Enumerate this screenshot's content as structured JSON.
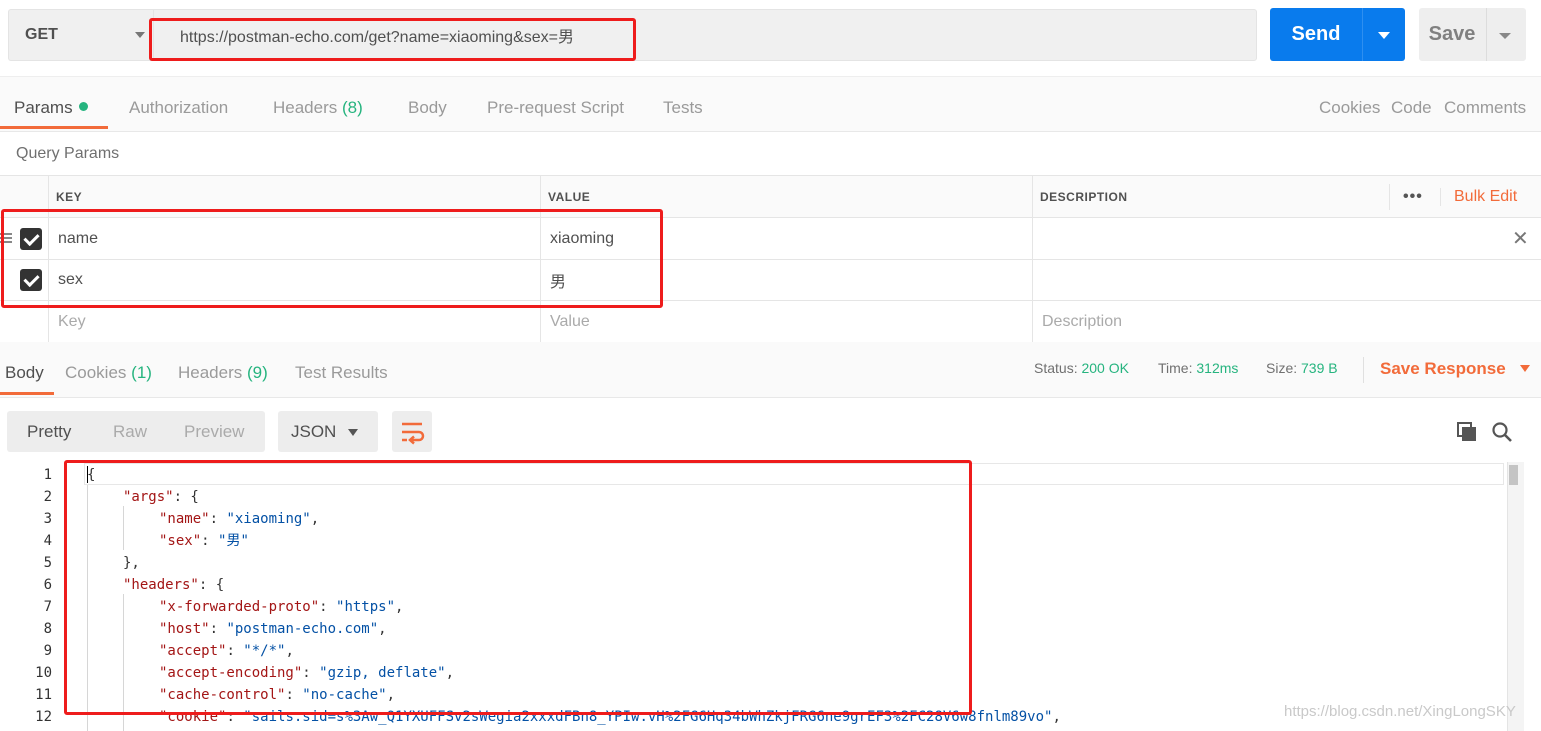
{
  "request": {
    "method": "GET",
    "url": "https://postman-echo.com/get?name=xiaoming&sex=男",
    "send_label": "Send",
    "save_label": "Save"
  },
  "request_tabs": [
    {
      "label": "Params",
      "active": true
    },
    {
      "label": "Authorization"
    },
    {
      "label": "Headers",
      "count": "(8)"
    },
    {
      "label": "Body"
    },
    {
      "label": "Pre-request Script"
    },
    {
      "label": "Tests"
    }
  ],
  "right_links": {
    "cookies": "Cookies",
    "code": "Code",
    "comments": "Comments"
  },
  "query_params": {
    "title": "Query Params",
    "headers": {
      "key": "KEY",
      "value": "VALUE",
      "description": "DESCRIPTION",
      "more": "•••",
      "bulk_edit": "Bulk Edit"
    },
    "rows": [
      {
        "key": "name",
        "value": "xiaoming",
        "checked": true
      },
      {
        "key": "sex",
        "value": "男",
        "checked": true
      }
    ],
    "placeholders": {
      "key": "Key",
      "value": "Value",
      "description": "Description"
    }
  },
  "response_tabs": [
    {
      "label": "Body",
      "active": true
    },
    {
      "label": "Cookies",
      "count": "(1)"
    },
    {
      "label": "Headers",
      "count": "(9)"
    },
    {
      "label": "Test Results"
    }
  ],
  "response_status": {
    "status_label": "Status:",
    "status_value": "200 OK",
    "time_label": "Time:",
    "time_value": "312ms",
    "size_label": "Size:",
    "size_value": "739 B",
    "save_response": "Save Response"
  },
  "view_modes": [
    "Pretty",
    "Raw",
    "Preview"
  ],
  "format": "JSON",
  "code_lines": [
    {
      "n": "1",
      "text": "{"
    },
    {
      "n": "2",
      "key": "\"args\"",
      "rest": ": {"
    },
    {
      "n": "3",
      "key": "\"name\"",
      "sep": ": ",
      "str": "\"xiaoming\"",
      "rest": ","
    },
    {
      "n": "4",
      "key": "\"sex\"",
      "sep": ": ",
      "str": "\"男\""
    },
    {
      "n": "5",
      "text": "},"
    },
    {
      "n": "6",
      "key": "\"headers\"",
      "rest": ": {"
    },
    {
      "n": "7",
      "key": "\"x-forwarded-proto\"",
      "sep": ": ",
      "str": "\"https\"",
      "rest": ","
    },
    {
      "n": "8",
      "key": "\"host\"",
      "sep": ": ",
      "str": "\"postman-echo.com\"",
      "rest": ","
    },
    {
      "n": "9",
      "key": "\"accept\"",
      "sep": ": ",
      "str": "\"*/*\"",
      "rest": ","
    },
    {
      "n": "10",
      "key": "\"accept-encoding\"",
      "sep": ": ",
      "str": "\"gzip, deflate\"",
      "rest": ","
    },
    {
      "n": "11",
      "key": "\"cache-control\"",
      "sep": ": ",
      "str": "\"no-cache\"",
      "rest": ","
    },
    {
      "n": "12",
      "key": "\"cookie\"",
      "sep": ": ",
      "str": "\"sails.sid=s%3Aw_Q1YXUFFSv2sWegia2xxxdFBn8_YPIw.vH%2FG6Hq34bWhZkjFRG6ne9grEF3%2FC28V6w8fnlm89vo\"",
      "rest": ","
    }
  ],
  "watermark": "https://blog.csdn.net/XingLongSKY",
  "colors": {
    "accent": "#f26b3a",
    "send_blue": "#097bed",
    "success": "#26b47f",
    "annotation": "#ee1c1c"
  }
}
